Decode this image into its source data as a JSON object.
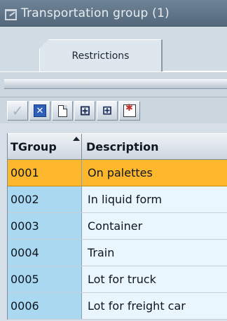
{
  "window": {
    "title": "Transportation group (1)"
  },
  "tabs": [
    {
      "label": "Restrictions",
      "active": true
    }
  ],
  "toolbar": {
    "buttons": [
      {
        "name": "confirm",
        "icon": "check-icon",
        "enabled": false
      },
      {
        "name": "cancel",
        "icon": "cancel-x-icon",
        "enabled": true
      },
      {
        "name": "new",
        "icon": "new-document-icon",
        "enabled": true
      },
      {
        "name": "find",
        "icon": "binoculars-icon",
        "enabled": true
      },
      {
        "name": "find-next",
        "icon": "binoculars-plus-icon",
        "enabled": true
      },
      {
        "name": "select",
        "icon": "select-star-icon",
        "enabled": true
      }
    ]
  },
  "table": {
    "columns": [
      {
        "label": "TGroup",
        "sorted": "ascending"
      },
      {
        "label": "Description"
      }
    ],
    "rows": [
      {
        "code": "0001",
        "description": "On palettes",
        "selected": true
      },
      {
        "code": "0002",
        "description": "In liquid form",
        "selected": false
      },
      {
        "code": "0003",
        "description": "Container",
        "selected": false
      },
      {
        "code": "0004",
        "description": "Train",
        "selected": false
      },
      {
        "code": "0005",
        "description": "Lot for truck",
        "selected": false
      },
      {
        "code": "0006",
        "description": "Lot for freight car",
        "selected": false
      }
    ]
  },
  "colors": {
    "selected_row": "#fdb72c",
    "key_column": "#a9d8f0",
    "text_column": "#eaf6fd",
    "titlebar": "#5f7386"
  }
}
